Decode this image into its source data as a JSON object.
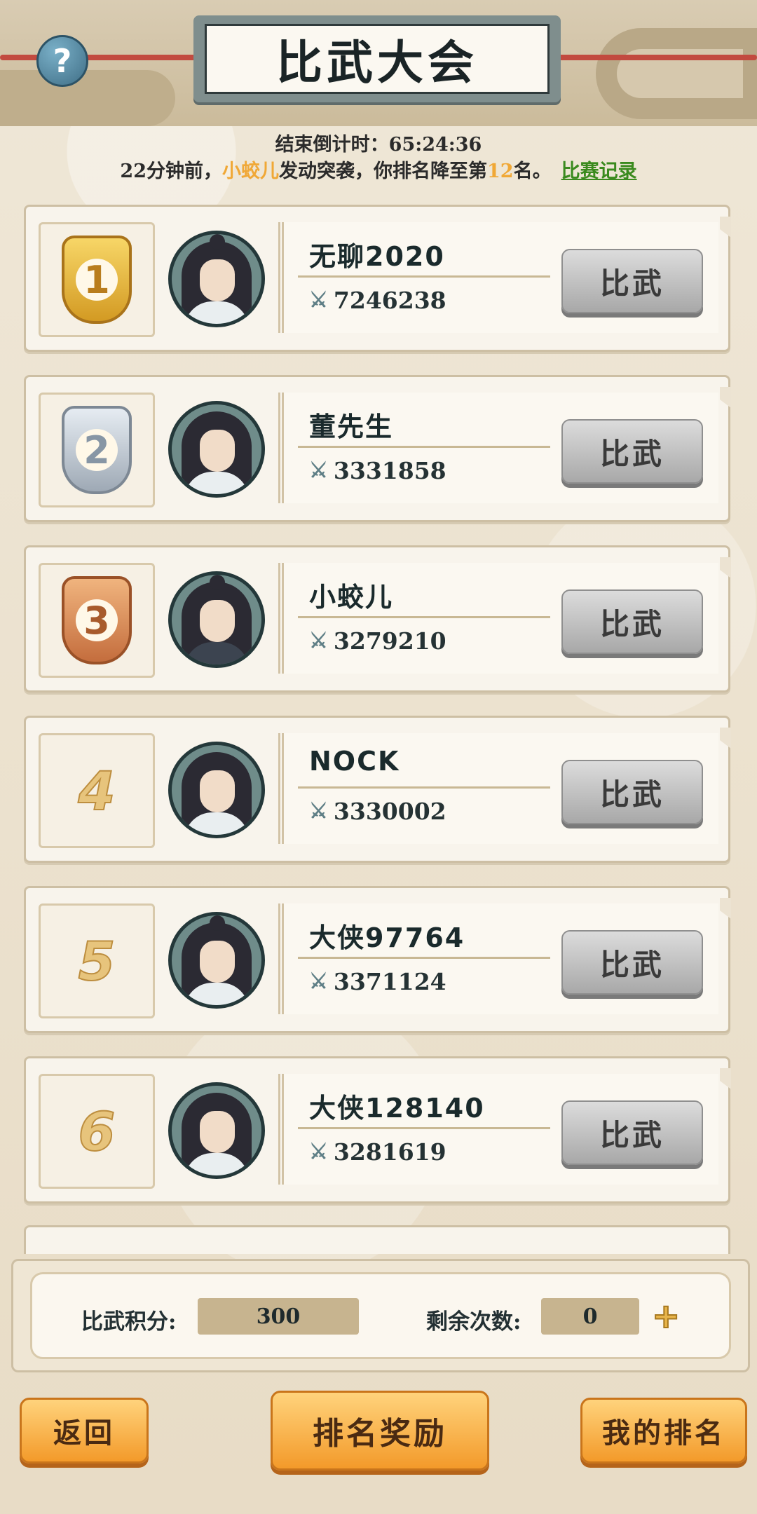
{
  "header": {
    "title": "比武大会",
    "help_label": "?"
  },
  "countdown": {
    "label": "结束倒计时：",
    "value": "65:24:36"
  },
  "notice": {
    "prefix": "22分钟前，",
    "attacker": "小蛟儿",
    "middle": "发动突袭，你排名降至第",
    "rank": "12",
    "suffix": "名。",
    "record_link": "比赛记录"
  },
  "fight_label": "比武",
  "players": [
    {
      "rank": "1",
      "name": "无聊2020",
      "power": "7246238",
      "medal": "gold"
    },
    {
      "rank": "2",
      "name": "董先生",
      "power": "3331858",
      "medal": "silver"
    },
    {
      "rank": "3",
      "name": "小蛟儿",
      "power": "3279210",
      "medal": "bronze"
    },
    {
      "rank": "4",
      "name": "NOCK",
      "power": "3330002",
      "medal": "none"
    },
    {
      "rank": "5",
      "name": "大侠97764",
      "power": "3371124",
      "medal": "none"
    },
    {
      "rank": "6",
      "name": "大侠128140",
      "power": "3281619",
      "medal": "none"
    }
  ],
  "stats": {
    "points_label": "比武积分:",
    "points_value": "300",
    "remaining_label": "剩余次数:",
    "remaining_value": "0"
  },
  "buttons": {
    "back": "返回",
    "rank_reward": "排名奖励",
    "my_rank": "我的排名"
  },
  "icons": {
    "help": "question-icon",
    "power": "crossed-swords-icon",
    "add": "plus-icon"
  },
  "colors": {
    "highlight": "#f0a836",
    "link": "#3a8a1e",
    "primary_button": "#f39a2a"
  }
}
